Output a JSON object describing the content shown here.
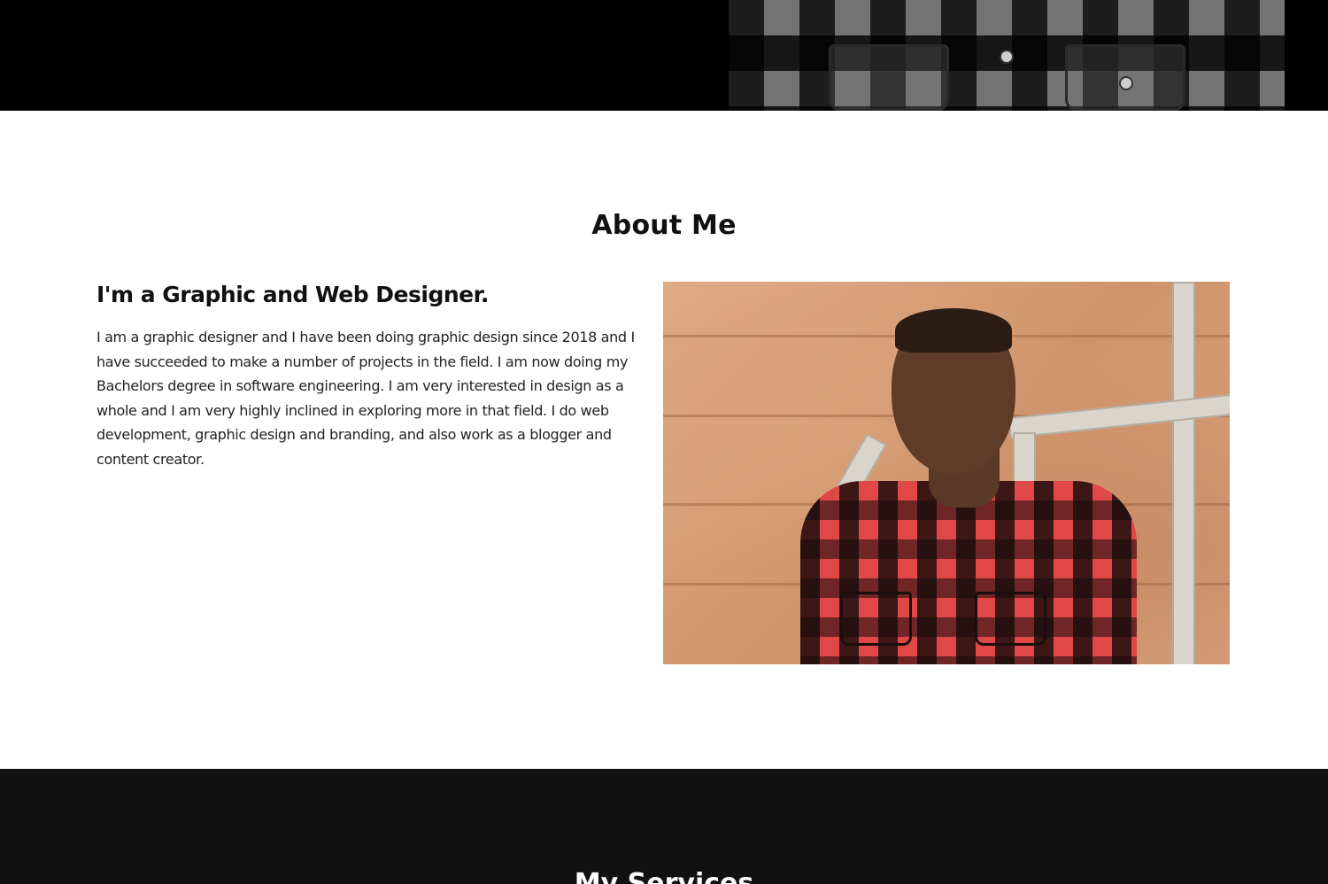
{
  "about": {
    "title": "About Me",
    "subtitle": "I'm a Graphic and Web Designer.",
    "body": "I am a graphic designer and I have been doing graphic design since 2018 and I have succeeded to make a number of projects in the field. I am now doing my Bachelors degree in software engineering. I am very interested in design as a whole and I am very highly inclined in exploring more in that field. I do web development, graphic design and branding, and also work as a blogger and content creator."
  },
  "services": {
    "title": "My Services"
  },
  "colors": {
    "hero_bg": "#000000",
    "page_bg": "#ffffff",
    "services_bg": "#111111",
    "text_dark": "#111111",
    "text_light": "#ffffff"
  }
}
